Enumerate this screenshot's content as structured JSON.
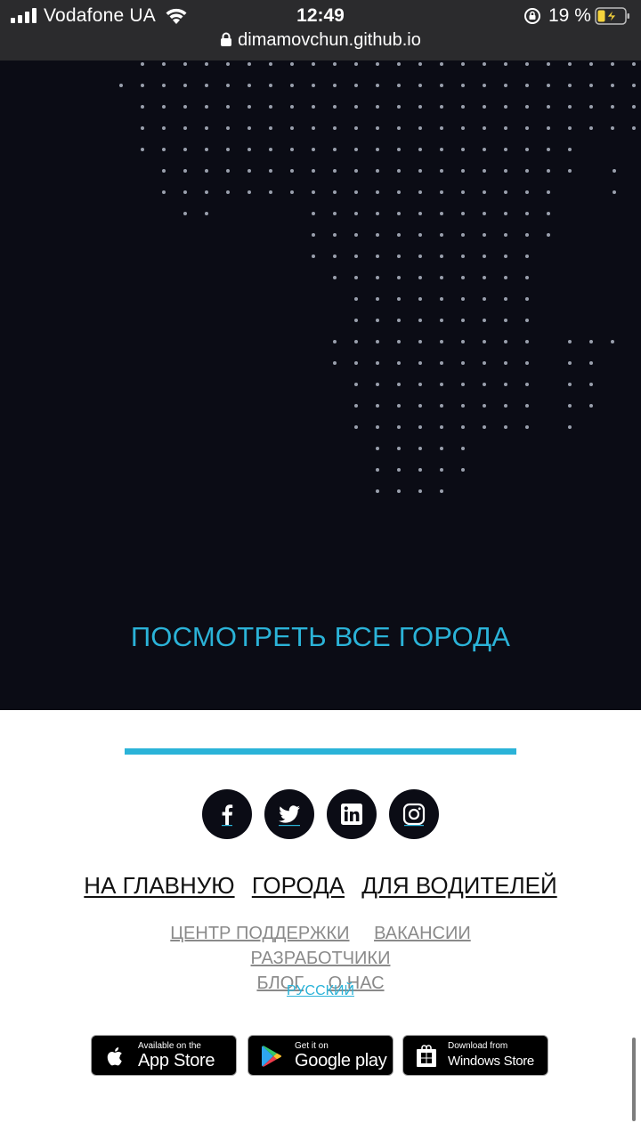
{
  "status_bar": {
    "carrier": "Vodafone UA",
    "time": "12:49",
    "battery_percent": "19 %",
    "icons": [
      "signal-icon",
      "wifi-icon",
      "orientation-lock-icon",
      "battery-charging-icon"
    ]
  },
  "browser": {
    "url": "dimamovchun.github.io"
  },
  "hero": {
    "cta_label": "ПОСМОТРЕТЬ ВСЕ ГОРОДА"
  },
  "footer": {
    "socials": [
      {
        "name": "facebook",
        "icon": "facebook-icon"
      },
      {
        "name": "twitter",
        "icon": "twitter-icon"
      },
      {
        "name": "linkedin",
        "icon": "linkedin-icon"
      },
      {
        "name": "instagram",
        "icon": "instagram-icon"
      }
    ],
    "main_links": [
      "НА ГЛАВНУЮ",
      "ГОРОДА",
      "ДЛЯ ВОДИТЕЛЕЙ"
    ],
    "secondary_links": [
      "ЦЕНТР ПОДДЕРЖКИ",
      "ВАКАНСИИ",
      "РАЗРАБОТЧИКИ",
      "БЛОГ",
      "О НАС"
    ],
    "language": "РУССКИЙ",
    "stores": [
      {
        "small": "Available on the",
        "big": "App Store"
      },
      {
        "small": "Get it on",
        "big": "Google play"
      },
      {
        "small": "Download from",
        "big": "Windows Store"
      }
    ]
  },
  "colors": {
    "accent": "#2bb3d8",
    "dark_bg": "#0b0c15",
    "status_bar_bg": "#2b2b2d",
    "battery_fill": "#f5d33c"
  }
}
